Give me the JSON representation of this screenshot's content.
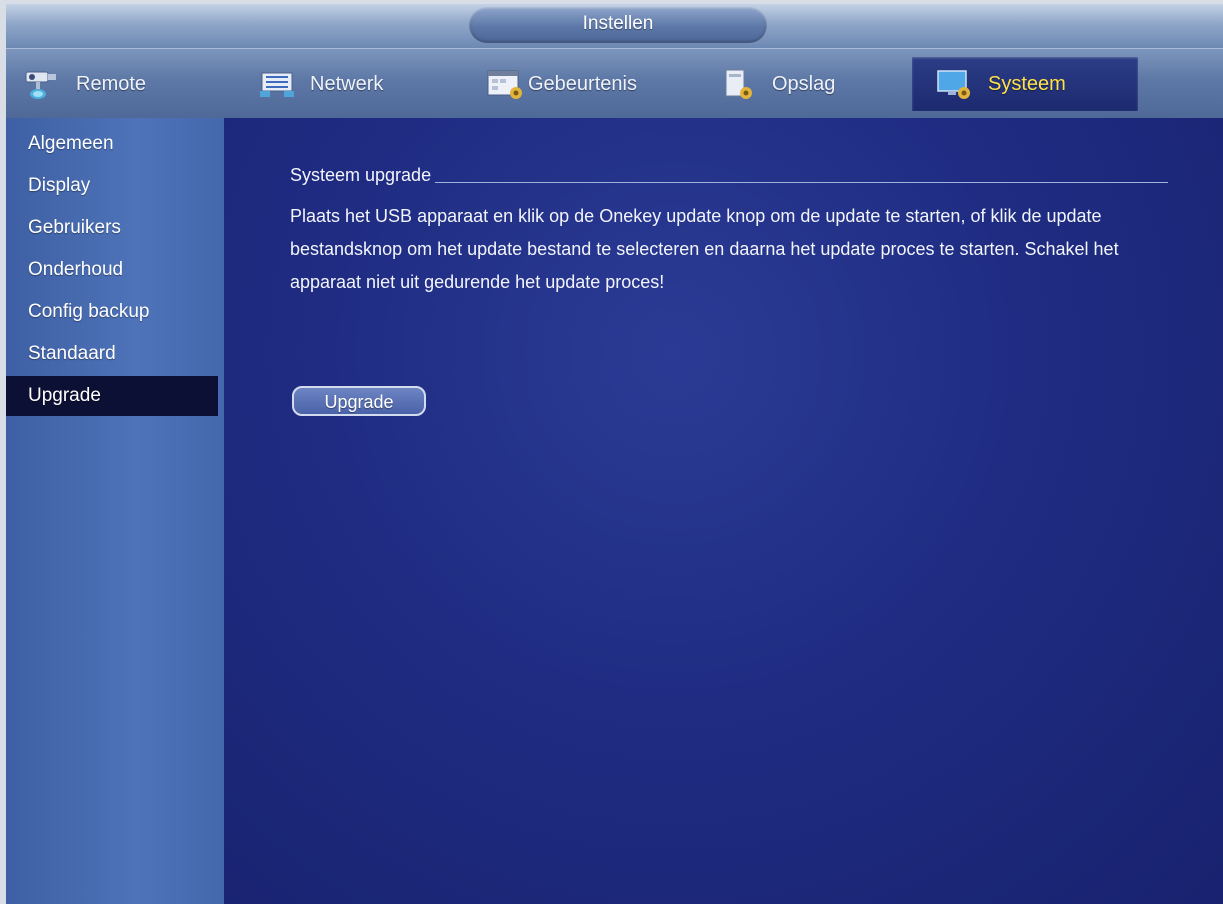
{
  "window": {
    "title": "Instellen"
  },
  "tabs": [
    {
      "label": "Remote",
      "icon": "camera-icon"
    },
    {
      "label": "Netwerk",
      "icon": "network-icon"
    },
    {
      "label": "Gebeurtenis",
      "icon": "event-icon"
    },
    {
      "label": "Opslag",
      "icon": "storage-icon"
    },
    {
      "label": "Systeem",
      "icon": "system-icon",
      "active": true
    }
  ],
  "sidebar": {
    "items": [
      {
        "label": "Algemeen"
      },
      {
        "label": "Display"
      },
      {
        "label": "Gebruikers"
      },
      {
        "label": "Onderhoud"
      },
      {
        "label": "Config backup"
      },
      {
        "label": "Standaard"
      },
      {
        "label": "Upgrade",
        "active": true
      }
    ]
  },
  "main": {
    "section_title": "Systeem upgrade",
    "description": "Plaats het USB apparaat en klik op de Onekey update knop om de update te starten, of klik de update bestandsknop om het update bestand te selecteren en daarna het update proces te starten. Schakel het apparaat niet uit gedurende het update proces!",
    "upgrade_button": "Upgrade"
  },
  "colors": {
    "background": "#1a237a",
    "active_tab_text": "#ffe24a",
    "active_sidebar": "#0d1035",
    "text": "#ffffff"
  }
}
